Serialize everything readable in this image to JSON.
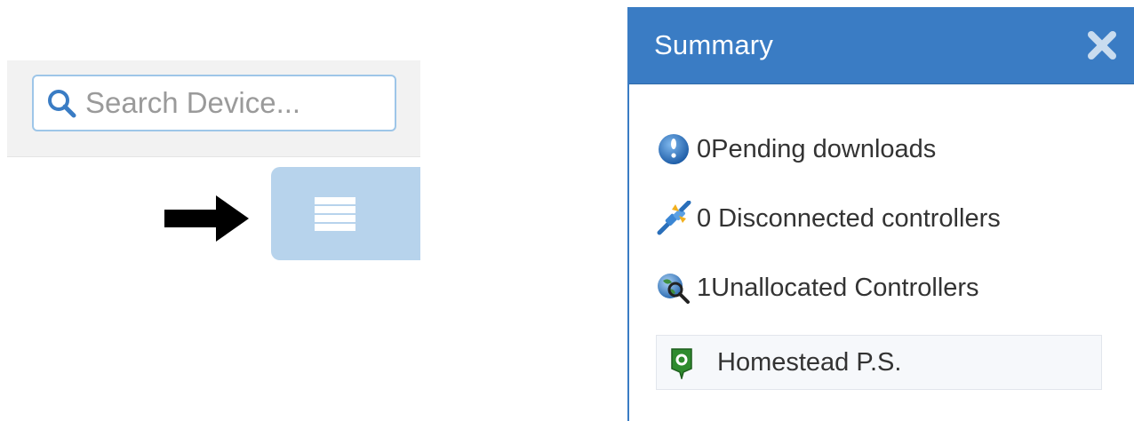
{
  "search": {
    "placeholder": "Search Device..."
  },
  "summary": {
    "title": "Summary",
    "rows": [
      {
        "icon": "info-globe-icon",
        "text": "0Pending downloads"
      },
      {
        "icon": "disconnected-plug-icon",
        "text": "0 Disconnected controllers"
      },
      {
        "icon": "globe-search-icon",
        "text": "1Unallocated Controllers"
      }
    ],
    "groups": [
      {
        "icon": "green-marker-icon",
        "text": "Homestead P.S."
      }
    ]
  },
  "colors": {
    "header_blue": "#3a7cc4",
    "toggle_blue": "#b7d3ec",
    "search_border": "#9ec6e8",
    "marker_green": "#2e8b2e"
  }
}
